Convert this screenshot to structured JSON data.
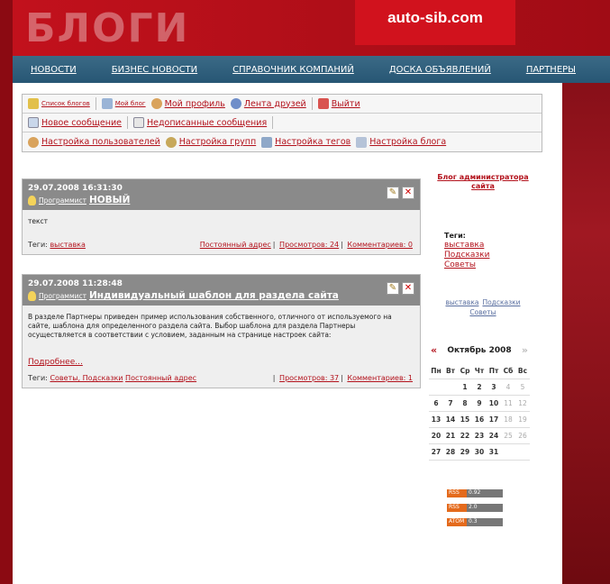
{
  "header": {
    "logo_text": "БЛОГИ",
    "site_name": "auto-sib.com"
  },
  "nav": {
    "items": [
      "НОВОСТИ",
      "БИЗНЕС НОВОСТИ",
      "СПРАВОЧНИК КОМПАНИЙ",
      "ДОСКА ОБЪЯВЛЕНИЙ",
      "ПАРТНЕРЫ"
    ]
  },
  "toolbar": {
    "row1": [
      "Список блогов",
      "Мой блог",
      "Мой профиль",
      "Лента друзей",
      "Выйти"
    ],
    "row2": [
      "Новое сообщение",
      "Недописанные сообщения"
    ],
    "row3": [
      "Настройка пользователей",
      "Настройка групп",
      "Настройка тегов",
      "Настройка блога"
    ]
  },
  "posts": [
    {
      "date": "29.07.2008 16:31:30",
      "category": "Программист",
      "title": "НОВЫЙ",
      "body": "текст",
      "tags_label": "Теги:",
      "tags": "выставка",
      "permalink": "Постоянный адрес",
      "views": "Просмотров: 24",
      "comments": "Комментариев: 0"
    },
    {
      "date": "29.07.2008 11:28:48",
      "category": "Программист",
      "title": "Индивидуальный шаблон для раздела сайта",
      "body": "В разделе Партнеры приведен пример использования собственного, отличного от используемого на сайте, шаблона для определенного раздела сайта. Выбор шаблона для раздела Партнеры осуществляется в соответствии с условием, заданным на странице настроек сайта:",
      "more": "Подробнее...",
      "tags_label": "Теги:",
      "tags": "Советы, Подсказки",
      "permalink": "Постоянный адрес",
      "views": "Просмотров: 37",
      "comments": "Комментариев: 1"
    }
  ],
  "sidebar": {
    "admin_blog": "Блог администратора сайта",
    "tags_label": "Теги:",
    "tags": [
      "выставка",
      "Подсказки",
      "Советы"
    ],
    "cloud": [
      "выставка",
      "Подсказки",
      "Советы"
    ],
    "calendar": {
      "month": "Октябрь 2008",
      "prev": "«",
      "next": "»",
      "weekdays": [
        "Пн",
        "Вт",
        "Ср",
        "Чт",
        "Пт",
        "Сб",
        "Вс"
      ],
      "weeks": [
        [
          "",
          "",
          "1",
          "2",
          "3",
          "4",
          "5"
        ],
        [
          "6",
          "7",
          "8",
          "9",
          "10",
          "11",
          "12"
        ],
        [
          "13",
          "14",
          "15",
          "16",
          "17",
          "18",
          "19"
        ],
        [
          "20",
          "21",
          "22",
          "23",
          "24",
          "25",
          "26"
        ],
        [
          "27",
          "28",
          "29",
          "30",
          "31",
          "",
          ""
        ]
      ]
    },
    "feeds": [
      {
        "type": "RSS",
        "version": "0.92"
      },
      {
        "type": "RSS",
        "version": "2.0"
      },
      {
        "type": "ATOM",
        "version": "0.3"
      }
    ]
  },
  "colors": {
    "accent": "#b3121c",
    "nav_bg": "#2f5f7c",
    "post_header": "#8a8a8a"
  }
}
